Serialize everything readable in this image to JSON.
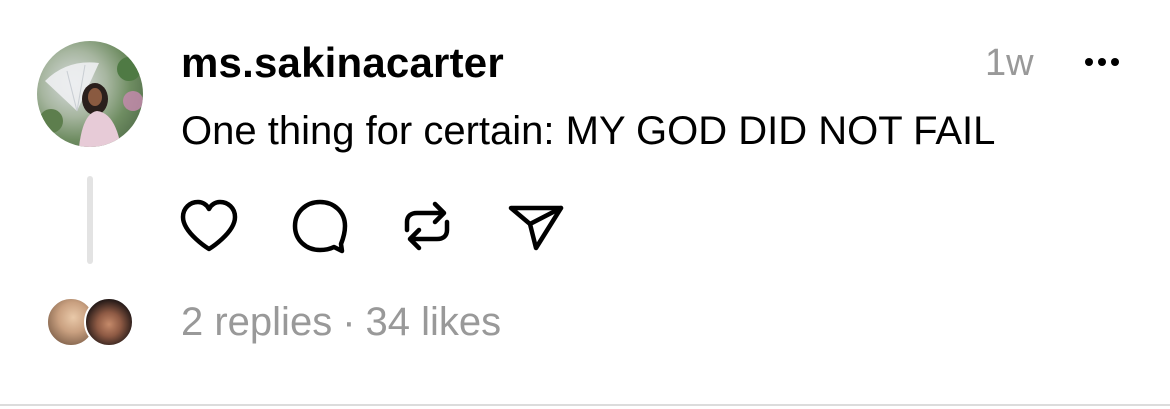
{
  "post": {
    "username": "ms.sakinacarter",
    "timestamp": "1w",
    "text": "One thing for certain: MY GOD DID NOT FAIL",
    "more_icon": "ellipsis-icon"
  },
  "actions": [
    {
      "name": "like",
      "icon": "heart-icon"
    },
    {
      "name": "reply",
      "icon": "comment-bubble-icon"
    },
    {
      "name": "repost",
      "icon": "repost-icon"
    },
    {
      "name": "share",
      "icon": "send-icon"
    }
  ],
  "stats": {
    "replies": "2 replies",
    "separator": "·",
    "likes": "34 likes"
  },
  "colors": {
    "text": "#000000",
    "muted": "#999999",
    "thread_line": "#e3e3e3"
  }
}
